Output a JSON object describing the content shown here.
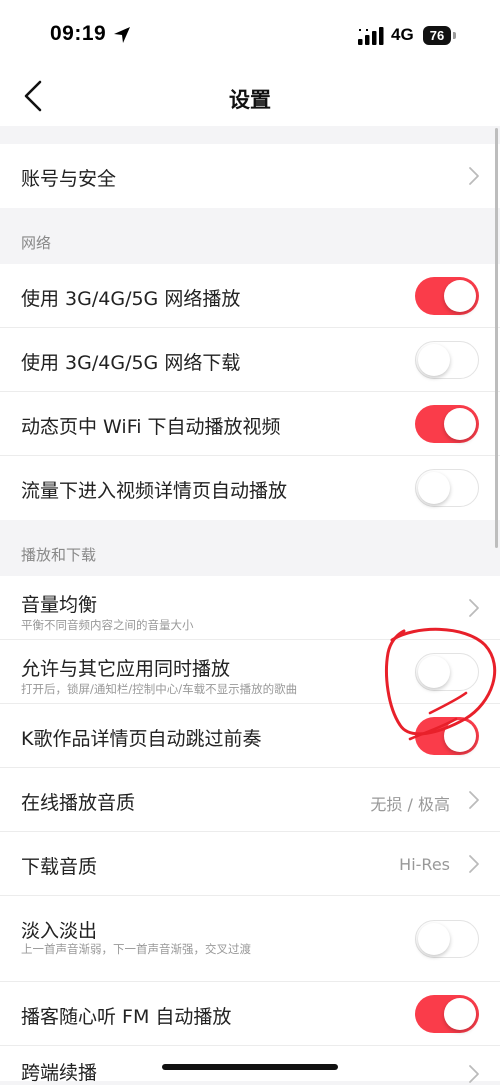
{
  "status_bar": {
    "time": "09:19",
    "network": "4G",
    "battery": "76"
  },
  "header": {
    "title": "设置"
  },
  "rows": {
    "account": {
      "title": "账号与安全"
    },
    "cell_play": {
      "title": "使用 3G/4G/5G 网络播放",
      "toggle_on": true
    },
    "cell_download": {
      "title": "使用 3G/4G/5G 网络下载",
      "toggle_on": false
    },
    "feed_wifi_autoplay": {
      "title": "动态页中 WiFi 下自动播放视频",
      "toggle_on": true
    },
    "data_video_autoplay": {
      "title": "流量下进入视频详情页自动播放",
      "toggle_on": false
    },
    "volume_balance": {
      "title": "音量均衡",
      "subtitle": "平衡不同音频内容之间的音量大小"
    },
    "mix_with_others": {
      "title": "允许与其它应用同时播放",
      "subtitle": "打开后，锁屏/通知栏/控制中心/车载不显示播放的歌曲",
      "toggle_on": false
    },
    "karaoke_skip_intro": {
      "title": "K歌作品详情页自动跳过前奏",
      "toggle_on": true
    },
    "online_quality": {
      "title": "在线播放音质",
      "value": "无损 / 极高"
    },
    "download_quality": {
      "title": "下载音质",
      "value": "Hi-Res"
    },
    "fade": {
      "title": "淡入淡出",
      "subtitle": "上一首声音渐弱，下一首声音渐强，交叉过渡",
      "toggle_on": false
    },
    "podcast_fm_autoplay": {
      "title": "播客随心听 FM 自动播放",
      "toggle_on": true
    },
    "handoff": {
      "title": "跨端续播"
    }
  },
  "sections": {
    "network": "网络",
    "playback": "播放和下载"
  },
  "colors": {
    "toggle_on": "#fa3c4a",
    "annotation": "#e8202a"
  }
}
